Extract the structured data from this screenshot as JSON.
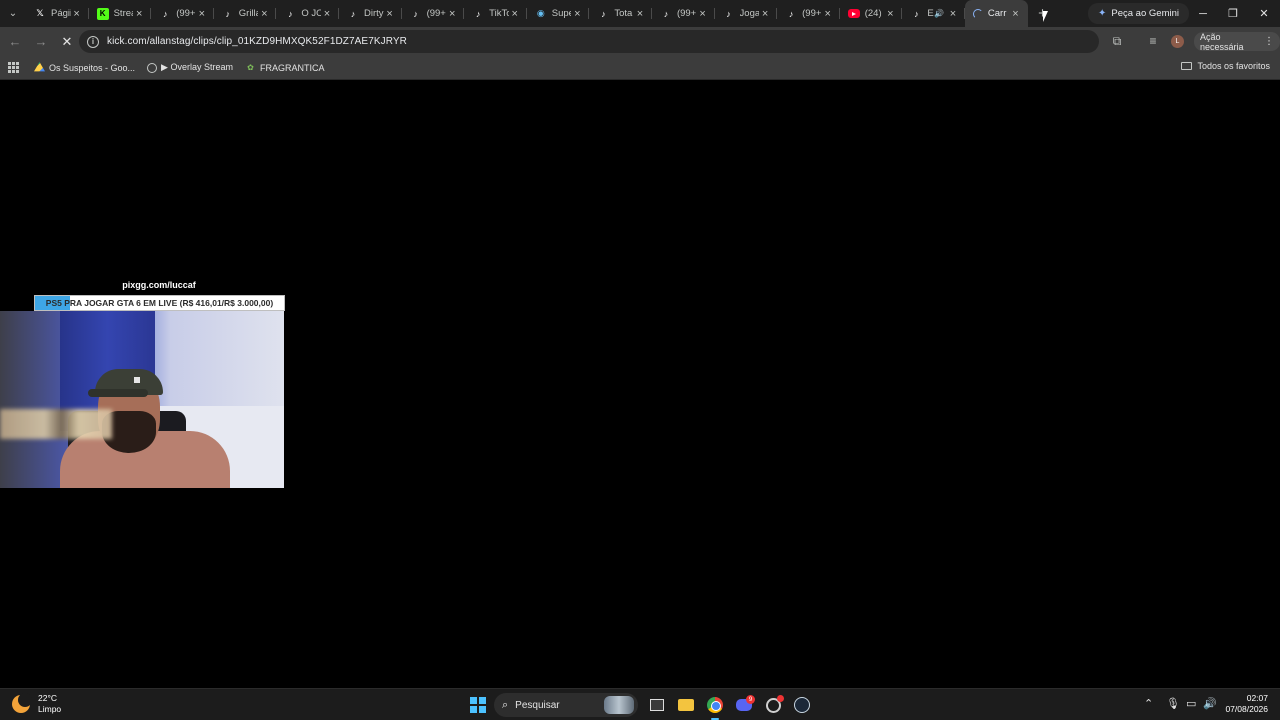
{
  "browser": {
    "tabs": [
      {
        "icon": "x-icon",
        "title": "Págii",
        "active": false
      },
      {
        "icon": "kick-icon",
        "title": "Strea",
        "active": false
      },
      {
        "icon": "tiktok-icon",
        "title": "(99+",
        "active": false
      },
      {
        "icon": "tiktok-icon",
        "title": "Grilla",
        "active": false
      },
      {
        "icon": "tiktok-icon",
        "title": "O JOG",
        "active": false
      },
      {
        "icon": "tiktok-icon",
        "title": "Dirty",
        "active": false
      },
      {
        "icon": "tiktok-icon",
        "title": "(99+",
        "active": false
      },
      {
        "icon": "tiktok-icon",
        "title": "TikTo",
        "active": false
      },
      {
        "icon": "steam-icon",
        "title": "Supe",
        "active": false
      },
      {
        "icon": "tiktok-icon",
        "title": "Tota",
        "active": false
      },
      {
        "icon": "tiktok-icon",
        "title": "(99+",
        "active": false
      },
      {
        "icon": "tiktok-icon",
        "title": "Joga",
        "active": false
      },
      {
        "icon": "tiktok-icon",
        "title": "(99+",
        "active": false
      },
      {
        "icon": "youtube-icon",
        "title": "(24)",
        "active": false
      },
      {
        "icon": "tiktok-icon",
        "title": "E",
        "active": false,
        "audio": true
      },
      {
        "icon": "loading-icon",
        "title": "Carr",
        "active": true
      }
    ],
    "gemini_label": "Peça ao Gemini",
    "url": "kick.com/allanstag/clips/clip_01KZD9HMXQK52F1DZ7AE7KJRYR",
    "action_needed": "Ação necessária",
    "profile_initial": "L",
    "bookmarks": [
      {
        "icon": "google-drive-icon",
        "label": "Os Suspeitos - Goo..."
      },
      {
        "icon": "globe-icon",
        "label": "▶ Overlay Stream"
      },
      {
        "icon": "fragrantica-icon",
        "label": "FRAGRANTICA"
      }
    ],
    "all_bookmarks": "Todos os favoritos"
  },
  "page": {
    "overlay_url": "pixgg.com/luccaf",
    "goal_text": "PS5 PRA JOGAR GTA 6 EM LIVE (R$ 416,01/R$ 3.000,00)",
    "goal_progress": 0.1387,
    "goal_color": "#3ea6e6"
  },
  "taskbar": {
    "temperature": "22°C",
    "weather": "Limpo",
    "search_placeholder": "Pesquisar",
    "discord_badge": "9",
    "time": "02:07",
    "date": "07/08/2026"
  }
}
